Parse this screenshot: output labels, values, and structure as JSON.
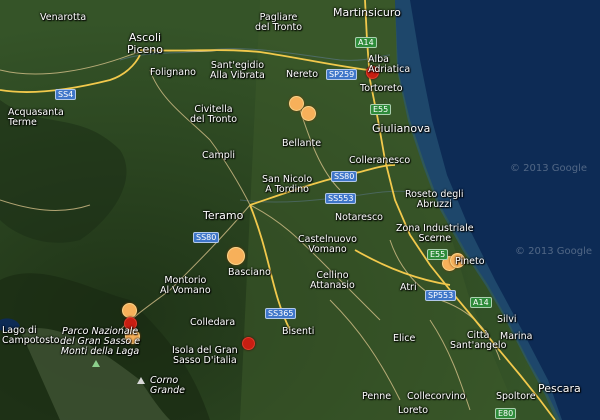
{
  "colors": {
    "terrain": "#2f4a22",
    "sea": "#0d2b55",
    "road_major": "#f2c94c",
    "road_minor": "#e0c890",
    "marker_orange": "#f7b05a",
    "marker_red": "#c81e12"
  },
  "places": [
    {
      "id": "venarotta",
      "text": "Venarotta"
    },
    {
      "id": "ascoli",
      "text": "Ascoli\nPiceno"
    },
    {
      "id": "pagliare",
      "text": "Pagliare\ndel Tronto"
    },
    {
      "id": "martinsicuro",
      "text": "Martinsicuro"
    },
    {
      "id": "alba",
      "text": "Alba\nAdriatica"
    },
    {
      "id": "folignano",
      "text": "Folignano"
    },
    {
      "id": "santegidio",
      "text": "Sant'egidio\nAlla Vibrata"
    },
    {
      "id": "nereto",
      "text": "Nereto"
    },
    {
      "id": "tortoreto",
      "text": "Tortoreto"
    },
    {
      "id": "acquasanta",
      "text": "Acquasanta\nTerme"
    },
    {
      "id": "civitella",
      "text": "Civitella\ndel Tronto"
    },
    {
      "id": "giulianova",
      "text": "Giulianova"
    },
    {
      "id": "bellante",
      "text": "Bellante"
    },
    {
      "id": "campli",
      "text": "Campli"
    },
    {
      "id": "colleranesco",
      "text": "Colleranesco"
    },
    {
      "id": "sannicolo",
      "text": "San Nicolo\nA Tordino"
    },
    {
      "id": "roseto",
      "text": "Roseto degli\nAbruzzi"
    },
    {
      "id": "teramo",
      "text": "Teramo"
    },
    {
      "id": "notaresco",
      "text": "Notaresco"
    },
    {
      "id": "zona",
      "text": "Zona Industriale\nScerne"
    },
    {
      "id": "castelnuovo",
      "text": "Castelnuovo\nVomano"
    },
    {
      "id": "basciano",
      "text": "Basciano"
    },
    {
      "id": "pineto",
      "text": "Pineto"
    },
    {
      "id": "montorio",
      "text": "Montorio\nAl Vomano"
    },
    {
      "id": "cellino",
      "text": "Cellino\nAttanasio"
    },
    {
      "id": "atri",
      "text": "Atri"
    },
    {
      "id": "lago",
      "text": "Lago di\nCampotosto"
    },
    {
      "id": "colledara",
      "text": "Colledara"
    },
    {
      "id": "bisenti",
      "text": "Bisenti"
    },
    {
      "id": "silvi",
      "text": "Silvi"
    },
    {
      "id": "parco",
      "text": "Parco Nazionale\ndel Gran Sasso e\nMonti della Laga"
    },
    {
      "id": "elice",
      "text": "Elice"
    },
    {
      "id": "citta",
      "text": "Città\nSant'angelo"
    },
    {
      "id": "marina",
      "text": "Marina"
    },
    {
      "id": "isola",
      "text": "Isola del Gran\nSasso D'italia"
    },
    {
      "id": "corno",
      "text": "Corno\nGrande"
    },
    {
      "id": "penne",
      "text": "Penne"
    },
    {
      "id": "collecorvino",
      "text": "Collecorvino"
    },
    {
      "id": "spoltore",
      "text": "Spoltore"
    },
    {
      "id": "pescara",
      "text": "Pescara"
    },
    {
      "id": "loreto",
      "text": "Loreto"
    }
  ],
  "road_shields": [
    {
      "id": "s4",
      "text": "SS4",
      "kind": "blue"
    },
    {
      "id": "a14n",
      "text": "A14",
      "kind": "green"
    },
    {
      "id": "sp259",
      "text": "SP259",
      "kind": "blue"
    },
    {
      "id": "e55n",
      "text": "E55",
      "kind": "green"
    },
    {
      "id": "ss80a",
      "text": "SS80",
      "kind": "blue"
    },
    {
      "id": "ss553",
      "text": "SS553",
      "kind": "blue"
    },
    {
      "id": "ss80b",
      "text": "SS80",
      "kind": "blue"
    },
    {
      "id": "e55s",
      "text": "E55",
      "kind": "green"
    },
    {
      "id": "sp553",
      "text": "SP553",
      "kind": "blue"
    },
    {
      "id": "a14s",
      "text": "A14",
      "kind": "green"
    },
    {
      "id": "ss365",
      "text": "SS365",
      "kind": "blue"
    },
    {
      "id": "e80",
      "text": "E80",
      "kind": "green"
    }
  ],
  "watermarks": [
    {
      "id": "wm1",
      "text": "© 2013 Google"
    },
    {
      "id": "wm2",
      "text": "© 2013 Google"
    }
  ],
  "markers": [
    {
      "id": "m1",
      "color": "red"
    },
    {
      "id": "m2",
      "color": "orange"
    },
    {
      "id": "m3",
      "color": "orange"
    },
    {
      "id": "m4",
      "color": "orange"
    },
    {
      "id": "m5",
      "color": "orange"
    },
    {
      "id": "m6",
      "color": "orange"
    },
    {
      "id": "m7",
      "color": "orange"
    },
    {
      "id": "m8",
      "color": "red"
    },
    {
      "id": "m9",
      "color": "orange"
    },
    {
      "id": "m10",
      "color": "red"
    }
  ]
}
